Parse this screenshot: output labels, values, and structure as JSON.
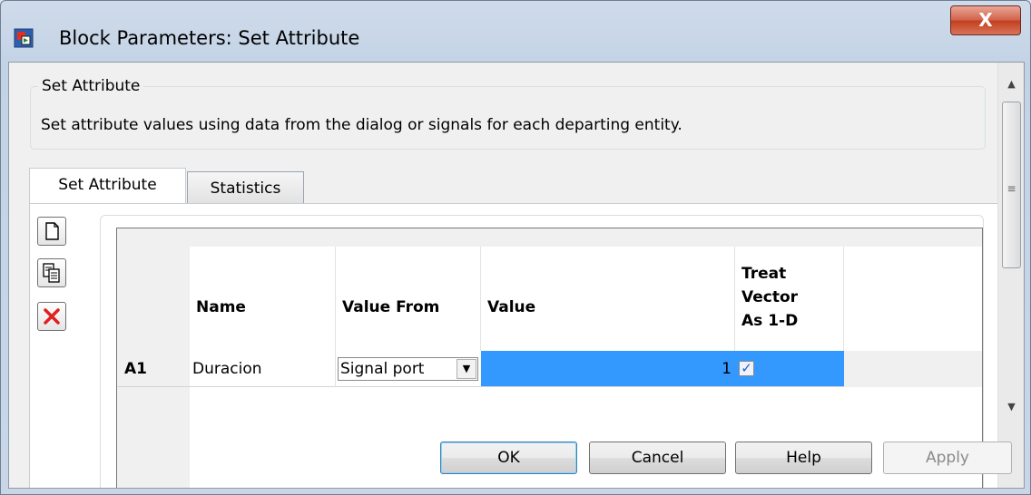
{
  "window": {
    "title": "Block Parameters: Set Attribute",
    "close_label": "X"
  },
  "group": {
    "legend": "Set Attribute",
    "description": "Set attribute values using data from the dialog or signals for each departing entity."
  },
  "tabs": [
    {
      "label": "Set Attribute",
      "active": true
    },
    {
      "label": "Statistics",
      "active": false
    }
  ],
  "side_buttons": [
    "new-row-icon",
    "copy-row-icon",
    "delete-row-icon"
  ],
  "table": {
    "headers": {
      "name": "Name",
      "value_from": "Value From",
      "value": "Value",
      "treat": "Treat\nVector\nAs 1-D"
    },
    "rows": [
      {
        "label": "A1",
        "name": "Duracion",
        "value_from": "Signal port",
        "value": "1",
        "treat_checked": true
      }
    ]
  },
  "buttons": {
    "ok": "OK",
    "cancel": "Cancel",
    "help": "Help",
    "apply": "Apply"
  },
  "colors": {
    "selection": "#3399ff",
    "close_button": "#c2401f"
  }
}
